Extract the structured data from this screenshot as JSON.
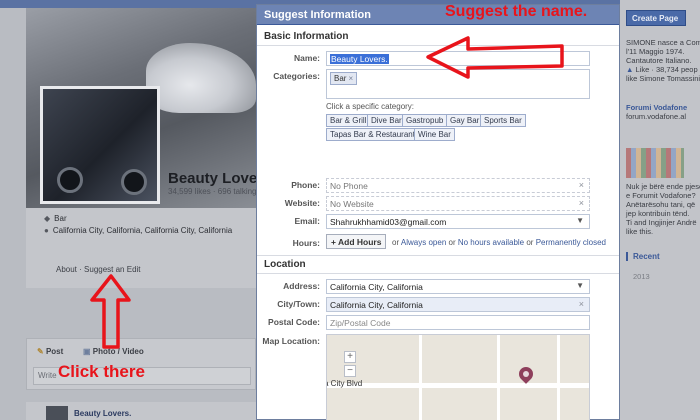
{
  "background": {
    "page_name": "Beauty Lovers",
    "page_stats": "34,599 likes · 696 talking a",
    "category": "Bar",
    "location": "California City, California, California City, California",
    "about_link": "About",
    "suggest_edit_link": "Suggest an Edit",
    "composer": {
      "post_tab": "Post",
      "photo_tab": "Photo / Video",
      "write_placeholder": "Write"
    },
    "post_author": "Beauty Lovers."
  },
  "sidebar": {
    "create_page_button": "Create Page",
    "text_lines": [
      "SIMONE nasce a Com",
      "l'11 Maggio 1974.",
      "Cantautore Italiano.",
      "Like · 38,734 peop",
      "like Simone Tomassini."
    ],
    "forum_title": "Forumi Vodafone",
    "forum_domain": "forum.vodafone.al",
    "forum_lines": [
      "Nuk je bërë ende pjesë",
      "e Forumit Vodafone?",
      "Anëtarësohu tani, që",
      "jep kontribuin tënd.",
      "Ti and Ingjinjer Andrë",
      "like this."
    ],
    "recent_label": "Recent",
    "recent_year": "2013"
  },
  "dialog": {
    "title": "Suggest Information",
    "basic_section": "Basic Information",
    "name_label": "Name:",
    "name_value": "Beauty Lovers.",
    "categories_label": "Categories:",
    "category_token": "Bar",
    "category_hint": "Click a specific category:",
    "category_chips": [
      "Bar & Grill",
      "Dive Bar",
      "Gastropub",
      "Gay Bar",
      "Sports Bar",
      "Tapas Bar & Restaurant",
      "Wine Bar"
    ],
    "phone_label": "Phone:",
    "phone_value": "No Phone",
    "website_label": "Website:",
    "website_value": "No Website",
    "email_label": "Email:",
    "email_value": "Shahrukhhamid03@gmail.com",
    "hours_label": "Hours:",
    "add_hours_button": "+ Add Hours",
    "hours_or1": "or",
    "hours_always_open": "Always open",
    "hours_or2": "or",
    "hours_no_hours": "No hours available",
    "hours_or3": "or",
    "hours_perm_closed": "Permanently closed",
    "location_section": "Location",
    "address_label": "Address:",
    "address_value": "California City, California",
    "city_label": "City/Town:",
    "city_value": "California City, California",
    "postal_label": "Postal Code:",
    "postal_placeholder": "Zip/Postal Code",
    "map_label": "Map Location:",
    "map_street": "a City Blvd",
    "zoom_in": "+",
    "zoom_out": "−"
  },
  "annotations": {
    "suggest_name": "Suggest the name.",
    "click_there": "Click there",
    "color": "#e8141b"
  }
}
